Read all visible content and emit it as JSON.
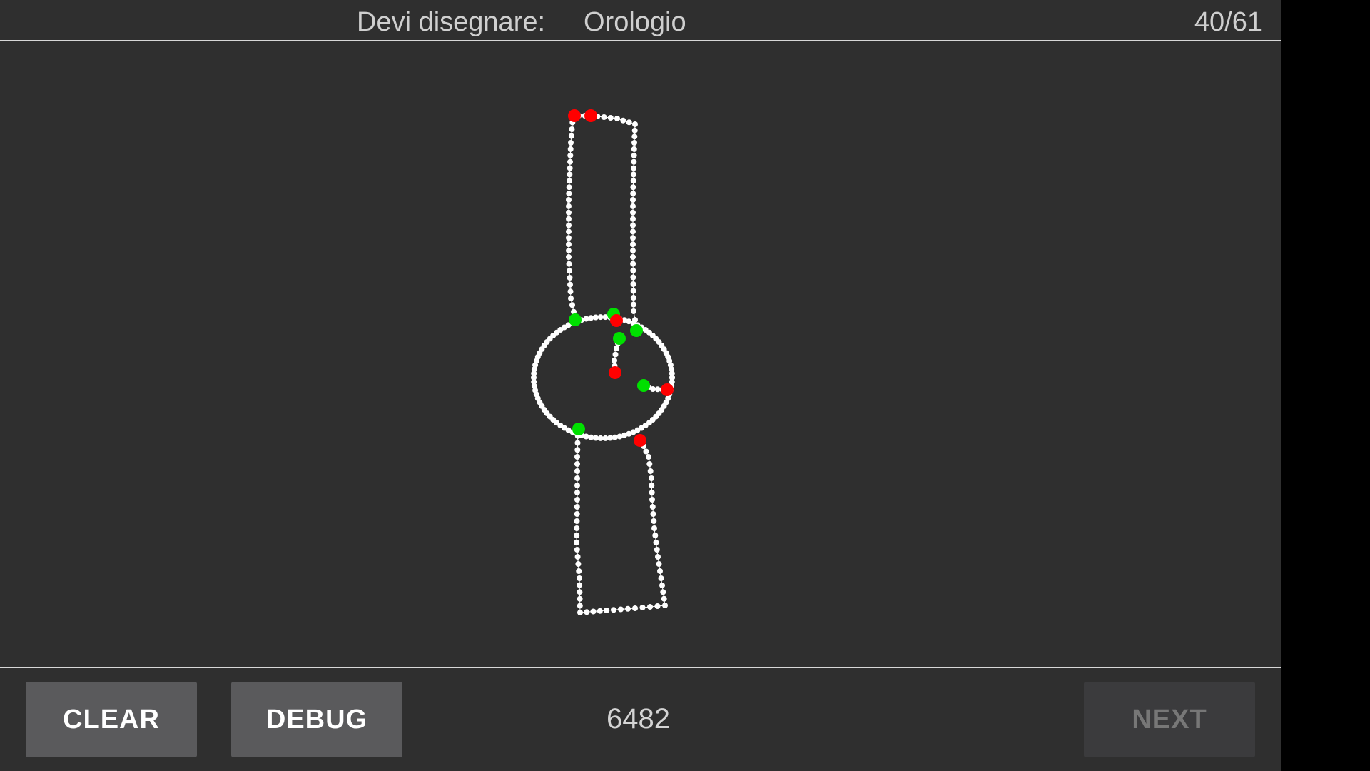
{
  "header": {
    "prompt_label": "Devi disegnare:",
    "prompt_word": "Orologio",
    "progress": "40/61"
  },
  "footer": {
    "clear_label": "CLEAR",
    "debug_label": "DEBUG",
    "score": "6482",
    "next_label": "NEXT",
    "next_enabled": false
  },
  "drawing": {
    "stroke_color": "#ffffff",
    "start_marker_color": "#00e000",
    "end_marker_color": "#ff0000"
  }
}
